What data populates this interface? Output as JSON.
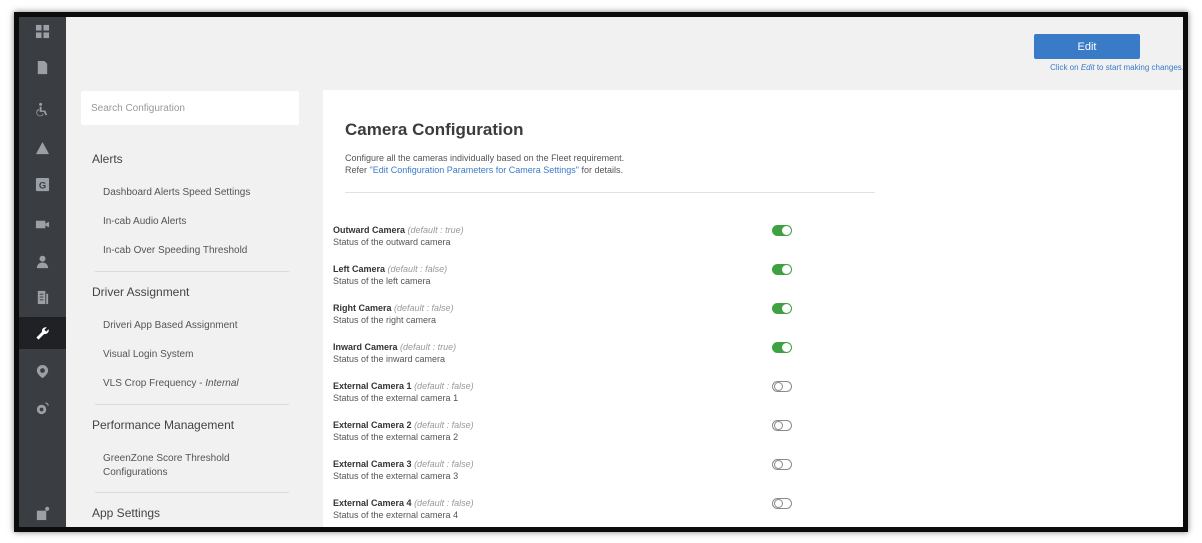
{
  "header": {
    "edit_label": "Edit",
    "edit_hint_prefix": "Click on ",
    "edit_hint_em": "Edit",
    "edit_hint_suffix": " to start making changes."
  },
  "sidebar_icons": [
    "dashboard-icon",
    "document-icon",
    "accessibility-icon",
    "alert-icon",
    "g-icon",
    "video-icon",
    "user-icon",
    "report-icon",
    "wrench-icon",
    "location-icon",
    "satellite-icon",
    "settings-icon"
  ],
  "config_nav": {
    "search_placeholder": "Search Configuration",
    "sections": [
      {
        "title": "Alerts",
        "items": [
          "Dashboard Alerts Speed Settings",
          "In-cab Audio Alerts",
          "In-cab Over Speeding Threshold"
        ]
      },
      {
        "title": "Driver Assignment",
        "items": [
          "Driveri App Based Assignment",
          "Visual Login System"
        ],
        "extra_item": {
          "text": "VLS Crop Frequency - ",
          "em": "Internal"
        }
      },
      {
        "title": "Performance Management",
        "items": [
          "GreenZone Score Threshold Configurations"
        ]
      },
      {
        "title": "App Settings",
        "items": []
      }
    ]
  },
  "main": {
    "title": "Camera Configuration",
    "desc_line1": "Configure all the cameras individually based on the Fleet requirement.",
    "desc_prefix": "Refer ",
    "desc_link": "\"Edit Configuration Parameters for Camera Settings\"",
    "desc_suffix": " for details.",
    "cameras": [
      {
        "name": "Outward Camera",
        "default": "(default : true)",
        "status": "Status of the outward camera",
        "enabled": true
      },
      {
        "name": "Left Camera",
        "default": "(default : false)",
        "status": "Status of the left camera",
        "enabled": true
      },
      {
        "name": "Right Camera",
        "default": "(default : false)",
        "status": "Status of the right camera",
        "enabled": true
      },
      {
        "name": "Inward Camera",
        "default": "(default : true)",
        "status": "Status of the inward camera",
        "enabled": true
      },
      {
        "name": "External Camera 1",
        "default": "(default : false)",
        "status": "Status of the external camera 1",
        "enabled": false
      },
      {
        "name": "External Camera 2",
        "default": "(default : false)",
        "status": "Status of the external camera 2",
        "enabled": false
      },
      {
        "name": "External Camera 3",
        "default": "(default : false)",
        "status": "Status of the external camera 3",
        "enabled": false
      },
      {
        "name": "External Camera 4",
        "default": "(default : false)",
        "status": "Status of the external camera 4",
        "enabled": false
      }
    ]
  },
  "colors": {
    "accent": "#3a7bc8",
    "toggle_on": "#3ea243",
    "rail_bg": "#3a3d41",
    "rail_active": "#1f2124"
  }
}
